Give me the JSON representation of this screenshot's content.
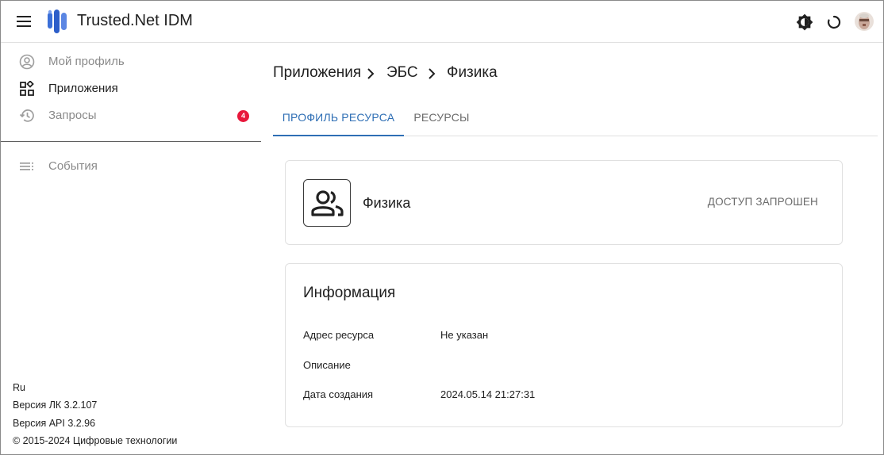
{
  "header": {
    "app_title": "Trusted.Net IDM",
    "menu_icon": "menu-icon",
    "theme_icon": "brightness-icon",
    "loader_icon": "loading-icon"
  },
  "sidebar": {
    "items": [
      {
        "label": "Мой профиль",
        "icon": "account-circle-icon",
        "active": false
      },
      {
        "label": "Приложения",
        "icon": "apps-grid-icon",
        "active": true
      },
      {
        "label": "Запросы",
        "icon": "history-icon",
        "active": false,
        "badge": "4"
      },
      {
        "label": "События",
        "icon": "list-icon",
        "active": false
      }
    ],
    "footer": {
      "language": "Ru",
      "version_lk": "Версия ЛК 3.2.107",
      "version_api": "Версия API 3.2.96",
      "copyright": "© 2015-2024 Цифровые технологии"
    }
  },
  "main": {
    "breadcrumb": [
      "Приложения",
      "ЭБС",
      "Физика"
    ],
    "tabs": [
      {
        "label": "ПРОФИЛЬ РЕСУРСА",
        "active": true
      },
      {
        "label": "РЕСУРСЫ",
        "active": false
      }
    ],
    "resource": {
      "name": "Физика",
      "status": "ДОСТУП ЗАПРОШЕН",
      "icon": "group-icon"
    },
    "info": {
      "title": "Информация",
      "rows": [
        {
          "key": "Адрес ресурса",
          "value": "Не указан"
        },
        {
          "key": "Описание",
          "value": ""
        },
        {
          "key": "Дата создания",
          "value": "2024.05.14 21:27:31"
        }
      ]
    }
  },
  "colors": {
    "accent": "#2f6fb5",
    "badge": "#e8173b",
    "logo": "#3b6fd8"
  }
}
